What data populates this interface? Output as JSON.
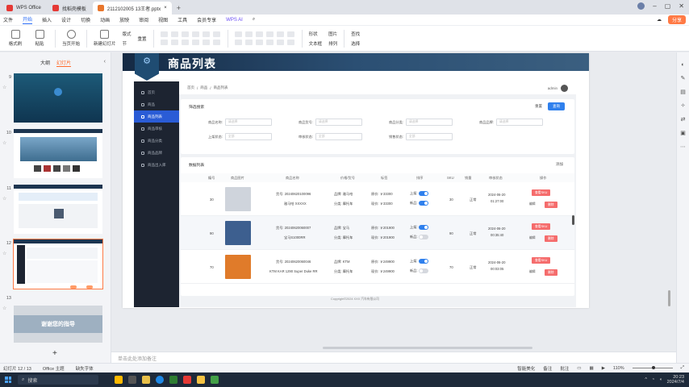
{
  "tabs": [
    {
      "label": "WPS Office",
      "active": false
    },
    {
      "label": "找稻壳模板",
      "active": false
    },
    {
      "label": "2112102005 13王者.pptx",
      "active": true
    }
  ],
  "menu": {
    "items": [
      "文件",
      "开始",
      "插入",
      "设计",
      "切换",
      "动画",
      "放映",
      "审阅",
      "视图",
      "工具",
      "会员专享"
    ],
    "active": "开始",
    "wps_ai": "WPS AI",
    "share": "分享"
  },
  "ribbon": {
    "format_painter": "格式刷",
    "paste": "粘贴",
    "from_start": "当页开始",
    "new_slide": "新建幻灯片",
    "layout": "版式",
    "section": "节",
    "reset": "重置",
    "shape": "形状",
    "picture": "图片",
    "textbox": "文本框",
    "arrange": "排列",
    "find": "查找",
    "select": "选择"
  },
  "left_panel": {
    "tab_outline": "大纲",
    "tab_slides": "幻灯片",
    "slides": [
      {
        "num": "9"
      },
      {
        "num": "10"
      },
      {
        "num": "11"
      },
      {
        "num": "12",
        "selected": true
      },
      {
        "num": "13",
        "text": "谢谢您的指导"
      }
    ]
  },
  "slide": {
    "title": "商品列表",
    "app": {
      "sidebar": [
        "首页",
        "商品",
        "商品列表",
        "商品审核",
        "商品分类",
        "商品品牌",
        "商品出入库"
      ],
      "sidebar_active": 2,
      "breadcrumb": [
        "首页",
        "商品",
        "商品列表"
      ],
      "user": "admin",
      "filter": {
        "title": "筛选搜索",
        "reset": "重置",
        "query": "查询",
        "fields": [
          {
            "label": "商品名称:",
            "placeholder": "请选择"
          },
          {
            "label": "商品货号:",
            "placeholder": "请选择"
          },
          {
            "label": "商品分类:",
            "placeholder": "请选择"
          },
          {
            "label": "商品品牌:",
            "placeholder": "请选择"
          },
          {
            "label": "上架状态:",
            "placeholder": "全部"
          },
          {
            "label": "审核状态:",
            "placeholder": "全部"
          },
          {
            "label": "销售状态:",
            "placeholder": "全部"
          }
        ]
      },
      "list": {
        "title": "数据列表",
        "add": "添加",
        "headers": [
          "编号",
          "商品图片",
          "商品名称",
          "价格/货号",
          "标签",
          "排序",
          "SKU",
          "销量",
          "审核状态",
          "发布时间",
          "操作"
        ],
        "rows": [
          {
            "id": "30",
            "name1": "货号: 20240620100096",
            "name2": "雅马哈 XXXXX",
            "brand": "品牌: 雅马哈",
            "cat": "分类: 摩托车",
            "price": "原价: ￥33300",
            "sale": "现价: ￥33300",
            "tag_on": "上架:",
            "tag_new": "新品:",
            "sort": "30",
            "sku": "正常",
            "time1": "2024-06-20",
            "time2": "01:27:00",
            "op1": "编辑",
            "op2": "删除",
            "op3": "查看SKU",
            "alt": false,
            "color": "#cfd4dc"
          },
          {
            "id": "90",
            "name1": "货号: 20240620060007",
            "name2": "宝马S1000RR",
            "brand": "品牌: 宝马",
            "cat": "分类: 摩托车",
            "price": "原价: ￥201900",
            "sale": "现价: ￥201900",
            "tag_on": "上架:",
            "tag_new": "新品:",
            "sort": "90",
            "sku": "正常",
            "time1": "2024-06-20",
            "time2": "00:35:40",
            "op1": "编辑",
            "op2": "删除",
            "op3": "查看SKU",
            "alt": true,
            "color": "#3d5f8f"
          },
          {
            "id": "70",
            "name1": "货号: 20240620060046",
            "name2": "KTM KAR 1290 Super Duke RR",
            "brand": "品牌: KTM",
            "cat": "分类: 摩托车",
            "price": "原价: ￥249900",
            "sale": "现价: ￥249900",
            "tag_on": "上架:",
            "tag_new": "新品:",
            "sort": "70",
            "sku": "正常",
            "time1": "2024-06-20",
            "time2": "00:03:05",
            "op1": "编辑",
            "op2": "删除",
            "op3": "查看SKU",
            "alt": false,
            "color": "#e07b2a"
          }
        ],
        "copyright": "Copyright©2024 XXX 汽车有限公司"
      }
    }
  },
  "notes_placeholder": "单击此处添加备注",
  "status": {
    "slide": "幻灯片 12 / 13",
    "theme": "Office 主题",
    "font_missing": "缺失字体",
    "beautify": "智能美化",
    "notes": "备注",
    "comments": "批注",
    "zoom": "110%"
  },
  "taskbar": {
    "search": "搜索",
    "time": "20:23",
    "date": "2024/7/4"
  }
}
